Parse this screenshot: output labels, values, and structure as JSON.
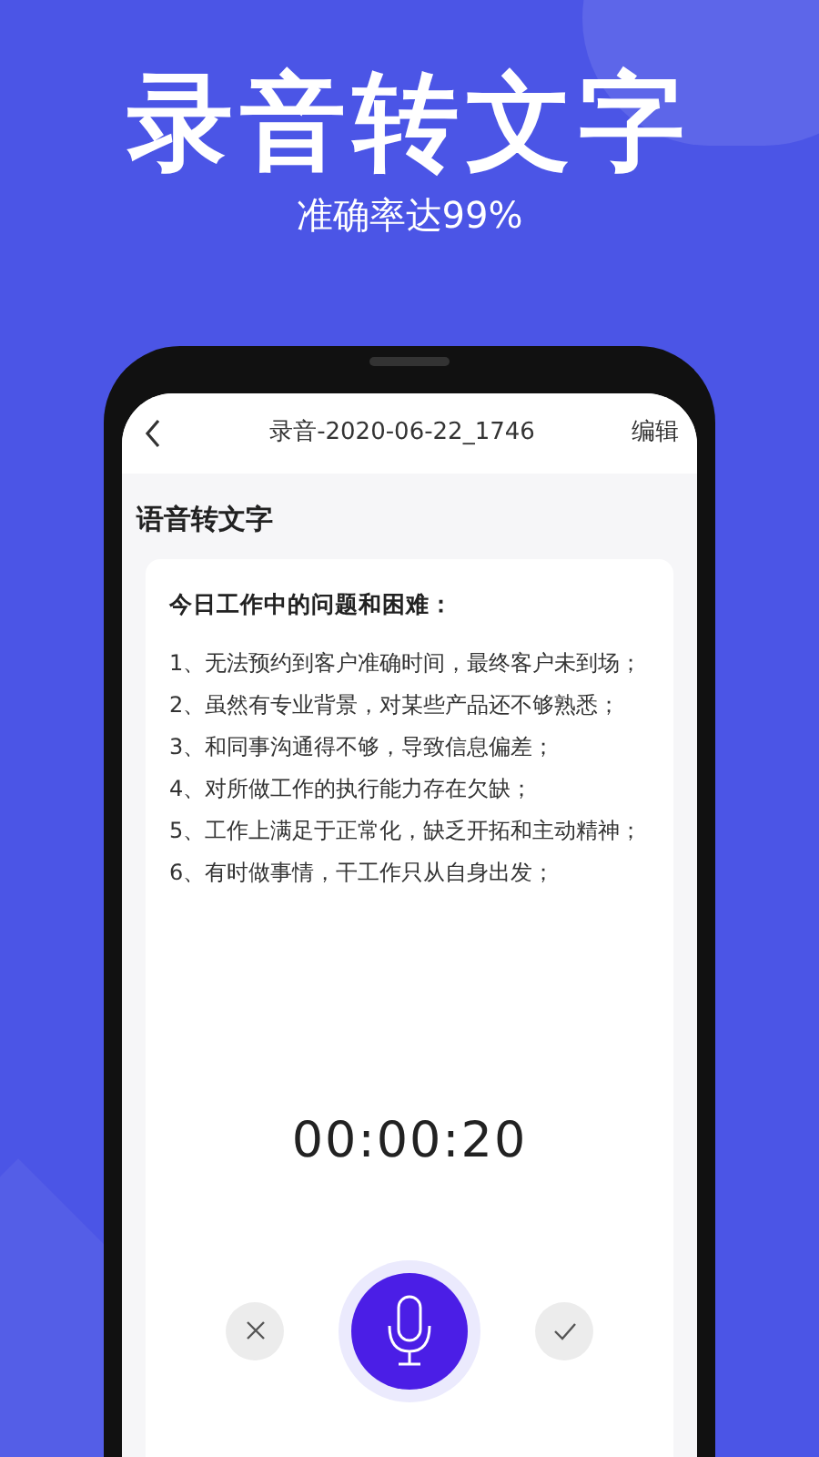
{
  "headline": "录音转文字",
  "subtitle": "准确率达99%",
  "nav": {
    "title": "录音-2020-06-22_1746",
    "action": "编辑"
  },
  "section_title": "语音转文字",
  "note": {
    "heading": "今日工作中的问题和困难：",
    "lines": [
      "1、无法预约到客户准确时间，最终客户未到场；",
      "2、虽然有专业背景，对某些产品还不够熟悉；",
      "3、和同事沟通得不够，导致信息偏差；",
      "4、对所做工作的执行能力存在欠缺；",
      "5、工作上满足于正常化，缺乏开拓和主动精神；",
      "6、有时做事情，干工作只从自身出发；"
    ]
  },
  "timer": "00:00:20"
}
